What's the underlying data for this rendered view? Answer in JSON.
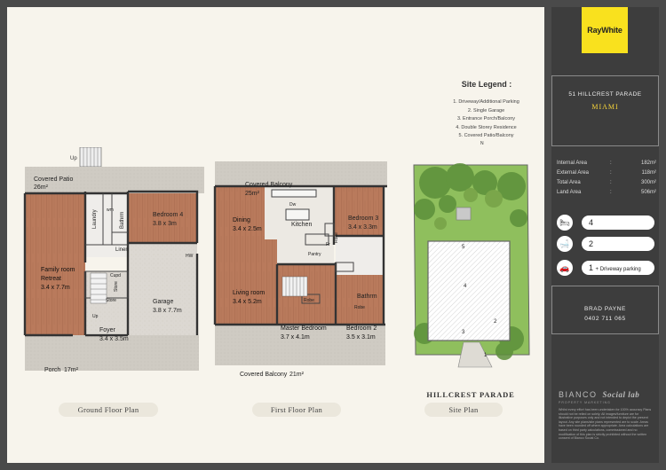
{
  "brand": {
    "logo_text": "RayWhite",
    "color": "#f9e11e"
  },
  "property": {
    "address": "51 HILLCREST PARADE",
    "suburb": "MIAMI"
  },
  "stats": [
    {
      "label": "Internal Area",
      "sep": ":",
      "value": "182m²"
    },
    {
      "label": "External Area",
      "sep": ":",
      "value": "118m²"
    },
    {
      "label": "Total Area",
      "sep": ":",
      "value": "300m²"
    },
    {
      "label": "Land Area",
      "sep": ":",
      "value": "506m²"
    }
  ],
  "features": {
    "bedrooms": {
      "icon": "bed-icon",
      "value": "4"
    },
    "bathrooms": {
      "icon": "bath-icon",
      "value": "2"
    },
    "parking": {
      "icon": "car-icon",
      "value": "1",
      "note": "+ Driveway parking"
    }
  },
  "agent": {
    "name": "BRAD PAYNE",
    "phone": "0402 711 065"
  },
  "footer": {
    "studio": "BIANCO",
    "studio_tag": "Social lab",
    "studio_sub": "PROPERTY MARKETING",
    "disclaimer": "Whilst every effort has been undertaken for 100% accuracy Plans should not be relied on solely. All images/furniture are for illustrative purposes only and not intended to depict the present layout. Any site plans/site plans represented are to scale. Areas have been rounded off where appropriate. Area calculations are based on third party calculations, commissioned and no modification of this plan is strictly prohibited without the written consent of Bianco Social Co."
  },
  "site_legend": {
    "title": "Site Legend :",
    "items": [
      "1. Driveway/Additional Parking",
      "2. Single Garage",
      "3. Entrance Porch/Balcony",
      "4. Double Storey Residence",
      "5. Covered Patio/Balcony"
    ]
  },
  "plans": {
    "ground": {
      "caption": "Ground Floor Plan",
      "rooms": {
        "up": "Up",
        "covered_patio": "Covered Patio",
        "covered_patio_area": "26m²",
        "laundry": "Laundry",
        "wm": "wm",
        "bathrm": "Bathrm",
        "linen": "Linen",
        "bedroom4": "Bedroom 4",
        "bedroom4_dim": "3.8 x 3m",
        "hw": "HW",
        "family": "Family room",
        "retreat": "Retreat",
        "family_dim": "3.4 x 7.7m",
        "cupd": "Cupd",
        "store1": "Store",
        "store2": "Store",
        "garage": "Garage",
        "garage_dim": "3.8 x 7.7m",
        "up2": "Up",
        "foyer": "Foyer",
        "foyer_dim": "3.4 x 3.5m",
        "porch": "Porch",
        "porch_area": "17m²"
      }
    },
    "first": {
      "caption": "First Floor Plan",
      "rooms": {
        "covered_balcony": "Covered Balcony",
        "covered_balcony_area": "25m²",
        "dw": "Dw",
        "kitchen": "Kitchen",
        "bedroom3": "Bedroom 3",
        "bedroom3_dim": "3.4 x 3.3m",
        "dining": "Dining",
        "dining_dim": "3.4 x 2.5m",
        "pantry": "Pantry",
        "fr": "Fr",
        "robe1": "Robe",
        "living": "Living room",
        "living_dim": "3.4 x 5.2m",
        "robe2": "Robe",
        "robe3": "Robe",
        "bathrm": "Bathrm",
        "master": "Master Bedroom",
        "master_dim": "3.7 x 4.1m",
        "bedroom2": "Bedroom 2",
        "bedroom2_dim": "3.5 x 3.1m",
        "balcony2": "Covered Balcony",
        "balcony2_area": "21m²"
      }
    },
    "site": {
      "caption": "Site Plan",
      "street": "HILLCREST PARADE",
      "north": "N",
      "markers": [
        "1",
        "2",
        "3",
        "4",
        "5"
      ]
    }
  }
}
